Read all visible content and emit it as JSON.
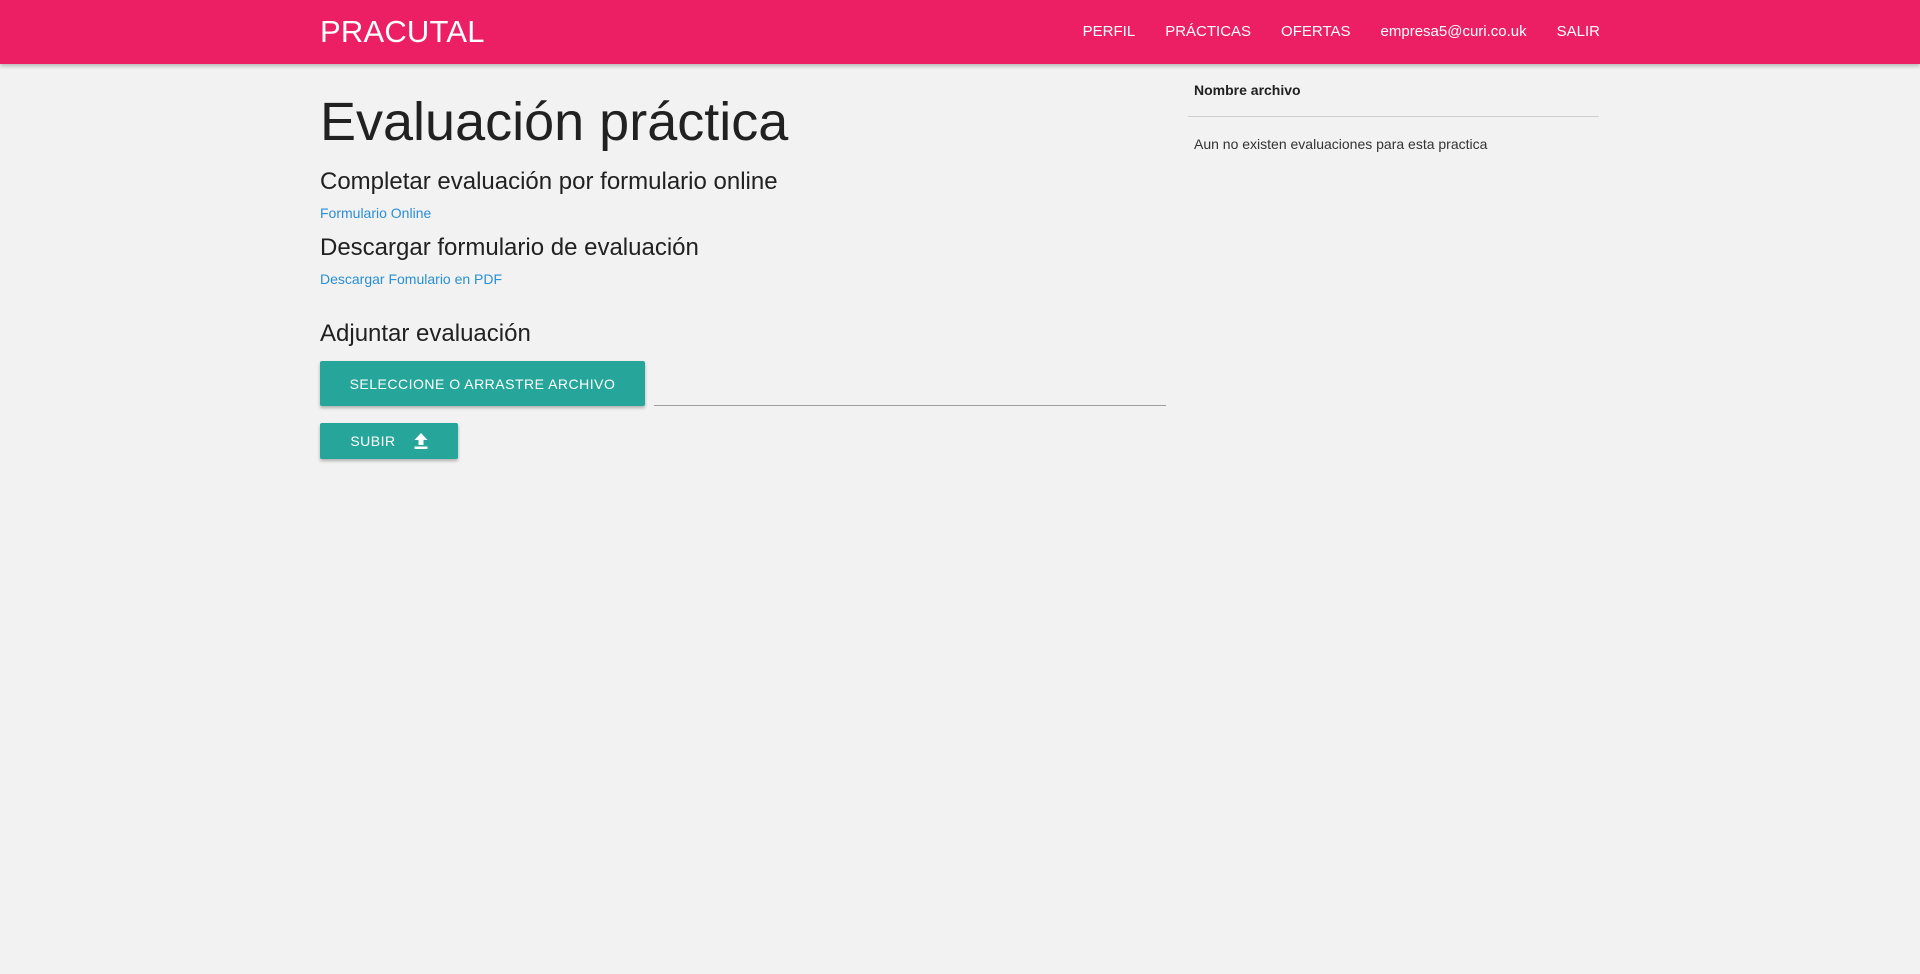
{
  "navbar": {
    "brand": "PRACUTAL",
    "links": [
      "PERFIL",
      "PRÁCTICAS",
      "OFERTAS",
      "empresa5@curi.co.uk",
      "SALIR"
    ]
  },
  "main": {
    "title": "Evaluación práctica",
    "online_section": {
      "heading": "Completar evaluación por formulario online",
      "link": "Formulario Online"
    },
    "download_section": {
      "heading": "Descargar formulario de evaluación",
      "link": "Descargar Fomulario en PDF"
    },
    "attach_section": {
      "heading": "Adjuntar evaluación",
      "select_button": "SELECCIONE O ARRASTRE ARCHIVO",
      "file_path_value": "",
      "upload_button": "SUBIR",
      "upload_icon": "upload-icon"
    }
  },
  "side_table": {
    "column_header": "Nombre archivo",
    "empty_message": "Aun no existen evaluaciones para esta practica"
  },
  "colors": {
    "navbar": "#ec1e64",
    "button": "#26a69a",
    "link": "#2a8fd6",
    "background": "#f2f2f2"
  }
}
